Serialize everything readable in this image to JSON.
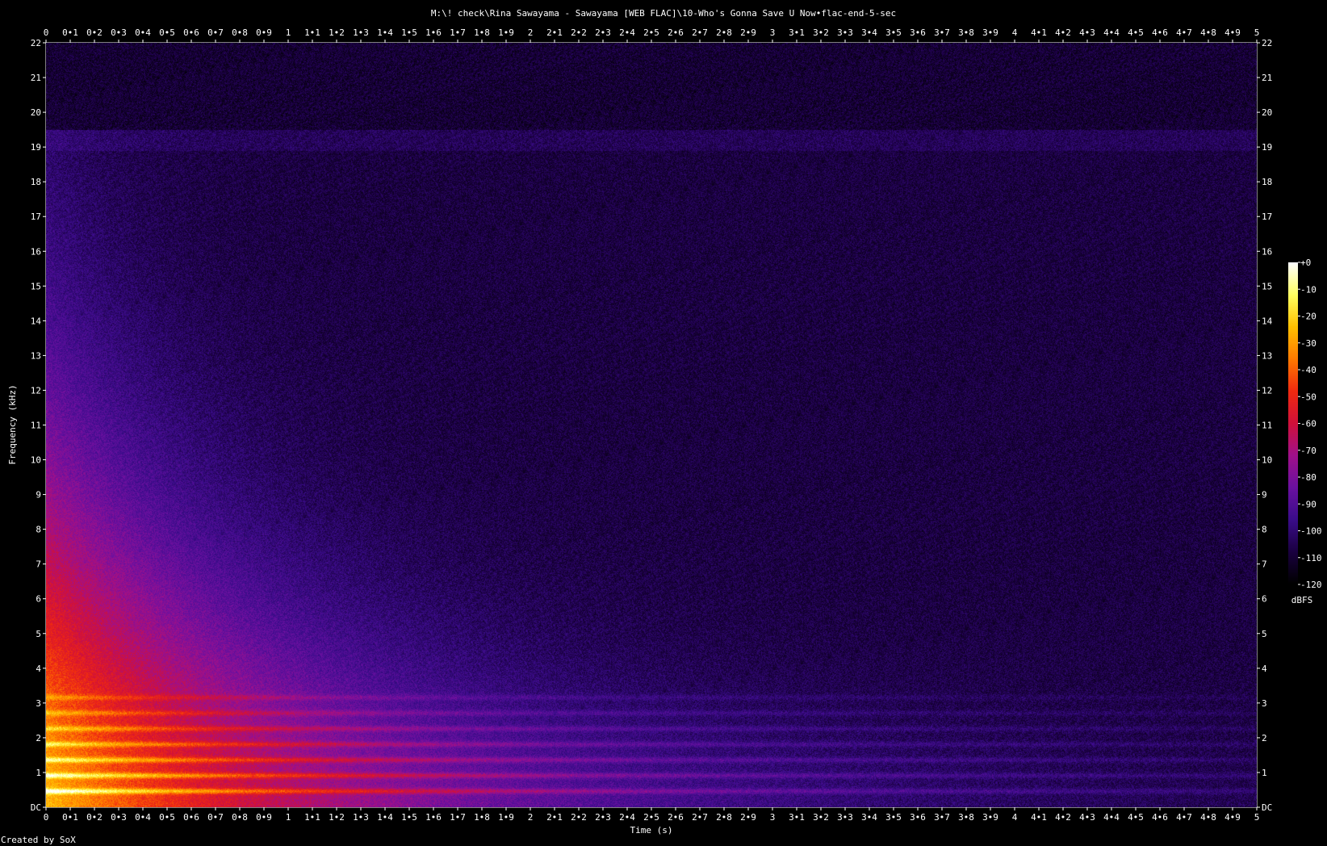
{
  "chart_data": {
    "type": "heatmap",
    "title": "M:\\! check\\Rina Sawayama - Sawayama [WEB FLAC]\\10-Who's Gonna Save U Now•flac-end-5-sec",
    "xlabel": "Time (s)",
    "ylabel": "Frequency (kHz)",
    "xlim": [
      0,
      5
    ],
    "ylim": [
      0,
      22
    ],
    "x_ticks": [
      "0",
      "0•1",
      "0•2",
      "0•3",
      "0•4",
      "0•5",
      "0•6",
      "0•7",
      "0•8",
      "0•9",
      "1",
      "1•1",
      "1•2",
      "1•3",
      "1•4",
      "1•5",
      "1•6",
      "1•7",
      "1•8",
      "1•9",
      "2",
      "2•1",
      "2•2",
      "2•3",
      "2•4",
      "2•5",
      "2•6",
      "2•7",
      "2•8",
      "2•9",
      "3",
      "3•1",
      "3•2",
      "3•3",
      "3•4",
      "3•5",
      "3•6",
      "3•7",
      "3•8",
      "3•9",
      "4",
      "4•1",
      "4•2",
      "4•3",
      "4•4",
      "4•5",
      "4•6",
      "4•7",
      "4•8",
      "4•9",
      "5"
    ],
    "y_ticks": [
      "DC",
      "1",
      "2",
      "3",
      "4",
      "5",
      "6",
      "7",
      "8",
      "9",
      "10",
      "11",
      "12",
      "13",
      "14",
      "15",
      "16",
      "17",
      "18",
      "19",
      "20",
      "21",
      "22"
    ],
    "colorbar": {
      "label": "dBFS",
      "range": [
        -120,
        0
      ],
      "ticks": [
        "+0",
        "-10",
        "-20",
        "-30",
        "-40",
        "-50",
        "-60",
        "-70",
        "-80",
        "-90",
        "-100",
        "-110",
        "-120"
      ],
      "colors": [
        "#000000",
        "#1a0040",
        "#3a0c8a",
        "#6a10a0",
        "#a0108a",
        "#d0103a",
        "#f02a10",
        "#ff7a00",
        "#ffc000",
        "#ffff60",
        "#ffffff"
      ]
    },
    "harmonic_bands_khz": [
      0.45,
      0.9,
      1.35,
      1.8,
      2.25,
      2.7,
      3.15
    ],
    "lowpass_khz": 19.5,
    "energy_decay": {
      "start_s": 0.0,
      "end_s": 5.0,
      "peak_dbfs": -25,
      "floor_dbfs": -108
    }
  },
  "footer": {
    "credit": "Created by SoX"
  }
}
